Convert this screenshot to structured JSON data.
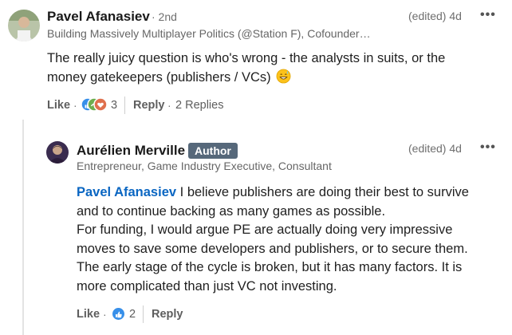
{
  "comment": {
    "author": "Pavel Afanasiev",
    "degree": "· 2nd",
    "headline": "Building Massively Multiplayer Politics (@Station F), Cofounder…",
    "meta": "(edited) 4d",
    "more": "•••",
    "text": "The really juicy question is who's wrong - the analysts in suits, or the money gatekeepers (publishers / VCs)",
    "emoji": "grinning-sweat-emoji",
    "like_label": "Like",
    "reaction_count": "3",
    "reply_label": "Reply",
    "replies_label": "2 Replies"
  },
  "reply": {
    "author": "Aurélien Merville",
    "badge": "Author",
    "headline": "Entrepreneur, Game Industry Executive, Consultant",
    "meta": "(edited) 4d",
    "more": "•••",
    "mention": "Pavel Afanasiev",
    "line1": " I believe publishers are doing their best to survive",
    "line2": "and to continue backing as many games as possible.",
    "line3": "For funding, I would argue PE are actually doing very impressive",
    "line4": "moves to save some developers and publishers, or to secure them.",
    "line5": "The early stage of the cycle is broken, but it has many factors. It is",
    "line6": "more complicated than just VC not investing.",
    "like_label": "Like",
    "reaction_count": "2",
    "reply_label": "Reply"
  },
  "colors": {
    "mention": "#0a66c2",
    "badge_bg": "#56687a",
    "like_blue": "#378fe9"
  },
  "dot_separator": "·"
}
